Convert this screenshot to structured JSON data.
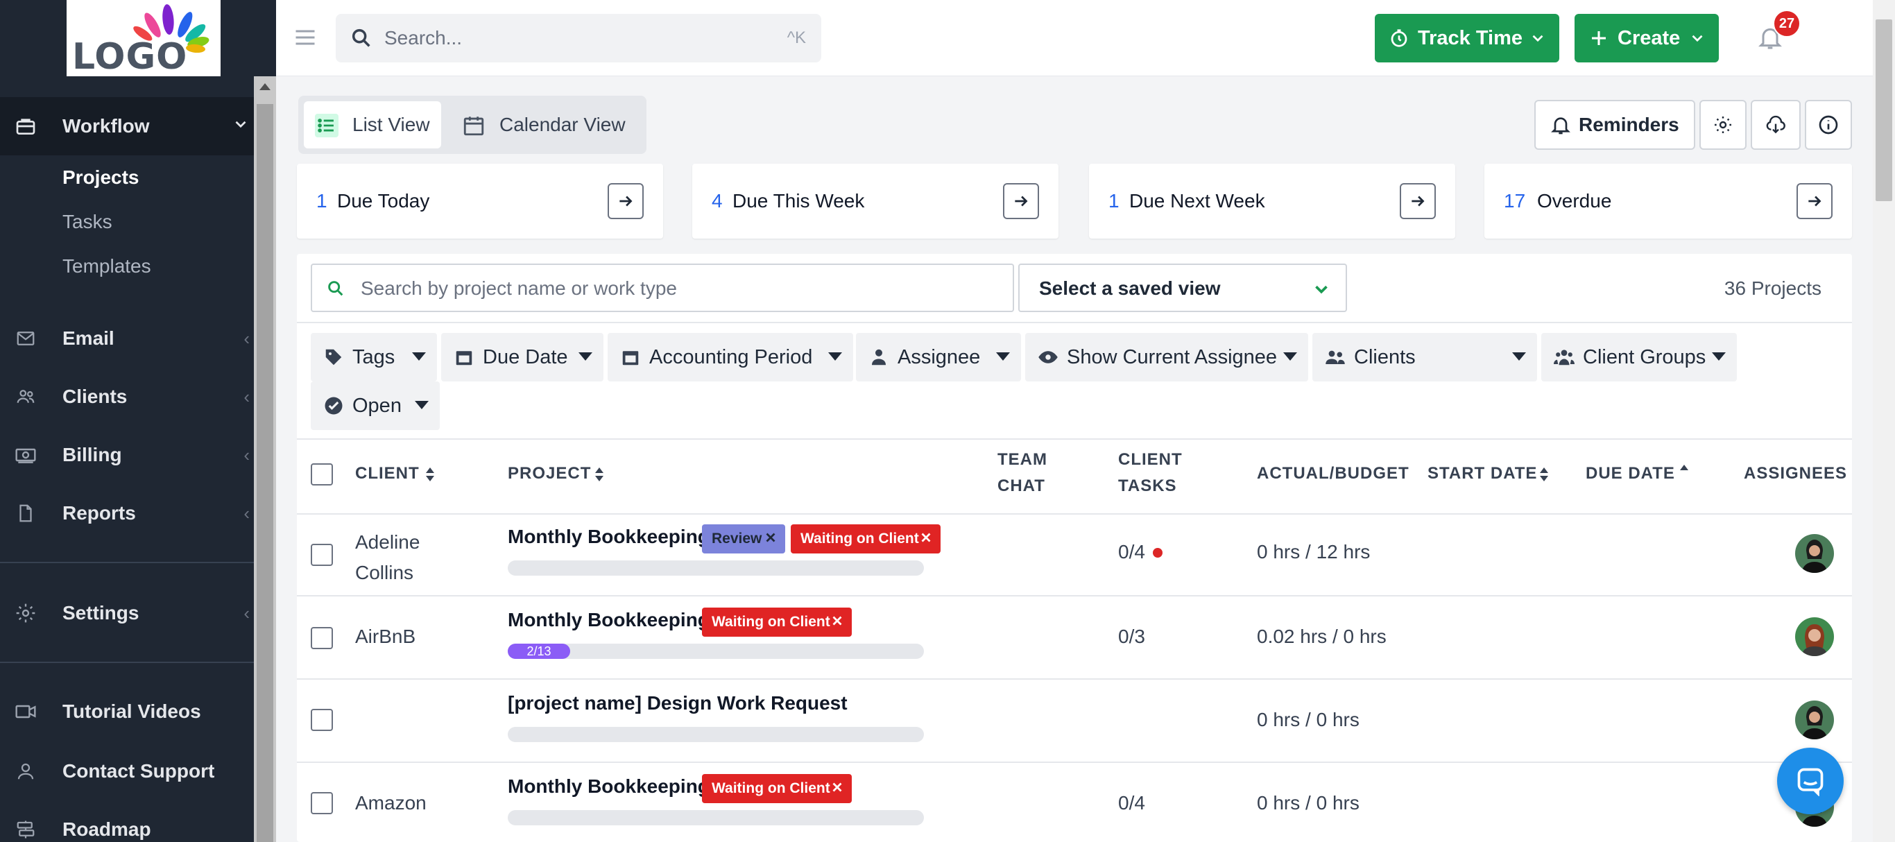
{
  "logo": {
    "text": "LOGO"
  },
  "sidebar": {
    "workflow_label": "Workflow",
    "workflow_sub": [
      "Projects",
      "Tasks",
      "Templates"
    ],
    "items": [
      {
        "label": "Email"
      },
      {
        "label": "Clients"
      },
      {
        "label": "Billing"
      },
      {
        "label": "Reports"
      }
    ],
    "settings_label": "Settings",
    "bottom": [
      {
        "label": "Tutorial Videos"
      },
      {
        "label": "Contact Support"
      },
      {
        "label": "Roadmap"
      }
    ]
  },
  "topbar": {
    "search_placeholder": "Search...",
    "search_shortcut": "^K",
    "track_time_label": "Track Time",
    "create_label": "Create",
    "notification_count": "27"
  },
  "views": {
    "list_label": "List View",
    "calendar_label": "Calendar View",
    "active": "list"
  },
  "toolbar": {
    "reminders_label": "Reminders"
  },
  "due_cards": [
    {
      "count": "1",
      "label": "Due Today"
    },
    {
      "count": "4",
      "label": "Due This Week"
    },
    {
      "count": "1",
      "label": "Due Next Week"
    },
    {
      "count": "17",
      "label": "Overdue"
    }
  ],
  "project_search": {
    "placeholder": "Search by project name or work type"
  },
  "saved_view": {
    "label": "Select a saved view"
  },
  "project_count": "36 Projects",
  "filters": [
    {
      "label": "Tags"
    },
    {
      "label": "Due Date"
    },
    {
      "label": "Accounting Period"
    },
    {
      "label": "Assignee"
    },
    {
      "label": "Show Current Assignee"
    },
    {
      "label": "Clients"
    },
    {
      "label": "Client Groups"
    },
    {
      "label": "Open"
    }
  ],
  "table": {
    "headers": {
      "client": "CLIENT",
      "project": "PROJECT",
      "team_chat_1": "TEAM",
      "team_chat_2": "CHAT",
      "client_tasks_1": "CLIENT",
      "client_tasks_2": "TASKS",
      "actual_budget": "ACTUAL/BUDGET",
      "start_date": "START DATE",
      "due_date": "DUE DATE",
      "assignees": "ASSIGNEES"
    },
    "rows": [
      {
        "client_1": "Adeline",
        "client_2": "Collins",
        "project": "Monthly Bookkeeping",
        "tags": [
          "Review",
          "Waiting on Client"
        ],
        "progress_label": "",
        "progress": 0,
        "client_tasks": "0/4",
        "has_alert": true,
        "actual_budget": "0 hrs / 12 hrs"
      },
      {
        "client_1": "AirBnB",
        "client_2": "",
        "project": "Monthly Bookkeeping",
        "tags": [
          "Waiting on Client"
        ],
        "progress_label": "2/13",
        "progress": 0.154,
        "client_tasks": "0/3",
        "has_alert": false,
        "actual_budget": "0.02 hrs / 0 hrs"
      },
      {
        "client_1": "",
        "client_2": "",
        "project": "[project name] Design Work Request",
        "tags": [],
        "progress_label": "",
        "progress": 0,
        "client_tasks": "",
        "has_alert": false,
        "actual_budget": "0 hrs / 0 hrs"
      },
      {
        "client_1": "Amazon",
        "client_2": "",
        "project": "Monthly Bookkeeping",
        "tags": [
          "Waiting on Client"
        ],
        "progress_label": "",
        "progress": 0,
        "client_tasks": "0/4",
        "has_alert": false,
        "actual_budget": "0 hrs / 0 hrs"
      }
    ]
  },
  "colors": {
    "sidebar_bg": "#1f2733",
    "accent_green": "#1a9a52",
    "tag_waiting": "#e02424",
    "tag_review": "#7c83db",
    "progress_fill": "#8b5cf6",
    "link_blue": "#2563eb"
  },
  "icons": [
    "hamburger-icon",
    "search-icon",
    "clock-icon",
    "plus-icon",
    "bell-icon",
    "logout-icon",
    "list-icon",
    "calendar-icon",
    "gear-icon",
    "cloud-download-icon",
    "info-icon",
    "arrow-right-icon",
    "tag-icon",
    "user-icon",
    "eye-icon",
    "users-icon",
    "check-circle-icon",
    "chat-icon"
  ]
}
